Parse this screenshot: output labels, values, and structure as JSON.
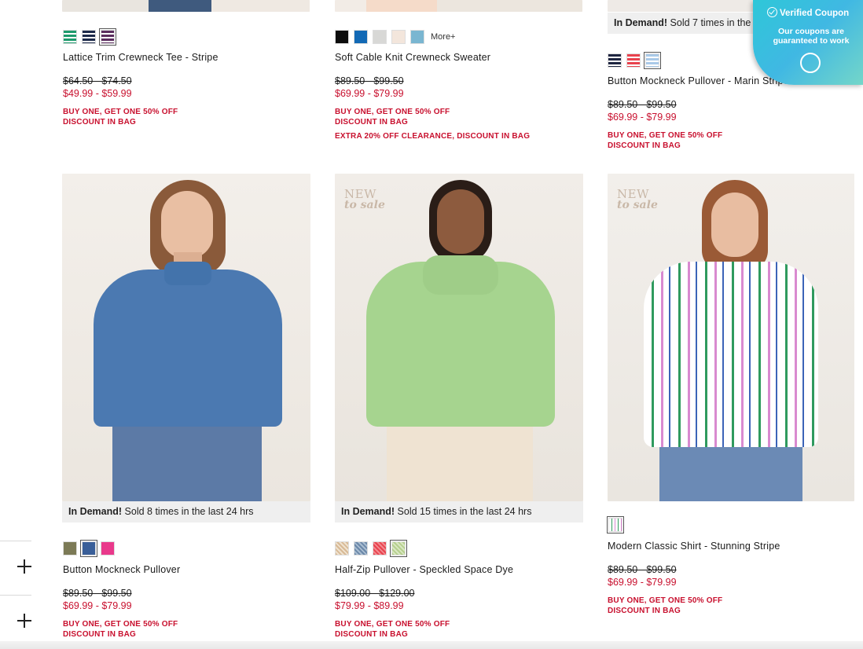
{
  "coupon": {
    "title": "Verified Coupon",
    "subtitle": "Our coupons are guaranteed to work"
  },
  "top_row": [
    {
      "name": "Lattice Trim Crewneck Tee - Stripe",
      "swatches": [
        {
          "color": "#1d9a6c",
          "pattern": "stripe-green"
        },
        {
          "color": "#1d2a4a",
          "pattern": "stripe-navy"
        },
        {
          "color": "#5b2d5e",
          "pattern": "stripe-plum"
        }
      ],
      "price_original": "$64.50 - $74.50",
      "price_sale": "$49.99 - $59.99",
      "promos": [
        "BUY ONE, GET ONE 50% OFF",
        "DISCOUNT IN BAG"
      ]
    },
    {
      "name": "Soft Cable Knit Crewneck Sweater",
      "swatches": [
        {
          "color": "#0d0d0d"
        },
        {
          "color": "#1269b5"
        },
        {
          "color": "#d8d8d6"
        },
        {
          "color": "#f3e6dc"
        },
        {
          "color": "#7ab6d1"
        }
      ],
      "more_label": "More+",
      "price_original": "$89.50 - $99.50",
      "price_sale": "$69.99 - $79.99",
      "promos": [
        "BUY ONE, GET ONE 50% OFF",
        "DISCOUNT IN BAG",
        "EXTRA 20% OFF CLEARANCE, DISCOUNT IN BAG"
      ]
    },
    {
      "name": "Button Mockneck Pullover - Marin Stripe",
      "demand_bold": "In Demand!",
      "demand_text": "Sold 7 times in the last 24 hrs",
      "swatches": [
        {
          "color": "#1e2540"
        },
        {
          "color": "#e8424d"
        },
        {
          "color": "#a9c9e8"
        }
      ],
      "price_original": "$89.50 - $99.50",
      "price_sale": "$69.99 - $79.99",
      "promos": [
        "BUY ONE, GET ONE 50% OFF",
        "DISCOUNT IN BAG"
      ]
    }
  ],
  "bottom_row": [
    {
      "name": "Button Mockneck Pullover",
      "new_badge": "",
      "demand_bold": "In Demand!",
      "demand_text": "Sold 8 times in the last 24 hrs",
      "swatches": [
        {
          "color": "#7c7a56"
        },
        {
          "color": "#3a5f99"
        },
        {
          "color": "#e9398b"
        }
      ],
      "price_original": "$89.50 - $99.50",
      "price_sale": "$69.99 - $79.99",
      "promos": [
        "BUY ONE, GET ONE 50% OFF",
        "DISCOUNT IN BAG"
      ]
    },
    {
      "name": "Half-Zip Pullover - Speckled Space Dye",
      "new_badge_top": "NEW",
      "new_badge_bottom": "to sale",
      "demand_bold": "In Demand!",
      "demand_text": "Sold 15 times in the last 24 hrs",
      "swatches": [
        {
          "color": "#d7b995"
        },
        {
          "color": "#6a87a8"
        },
        {
          "color": "#e8424d"
        },
        {
          "color": "#b6cf8e"
        }
      ],
      "price_original": "$109.00 - $129.00",
      "price_sale": "$79.99 - $89.99",
      "promos": [
        "BUY ONE, GET ONE 50% OFF",
        "DISCOUNT IN BAG"
      ]
    },
    {
      "name": "Modern Classic Shirt - Stunning Stripe",
      "new_badge_top": "NEW",
      "new_badge_bottom": "to sale",
      "swatches": [
        {
          "color": "#f1d7e8"
        }
      ],
      "price_original": "$89.50 - $99.50",
      "price_sale": "$69.99 - $79.99",
      "promos": [
        "BUY ONE, GET ONE 50% OFF",
        "DISCOUNT IN BAG"
      ]
    }
  ]
}
